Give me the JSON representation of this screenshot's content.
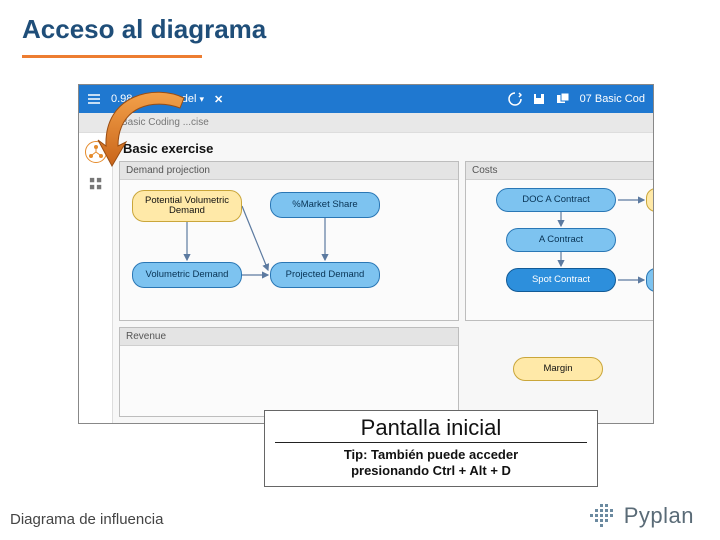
{
  "slide": {
    "title": "Acceso al diagrama",
    "caption_title": "Pantalla inicial",
    "caption_tip_line1": "Tip: También puede acceder",
    "caption_tip_line2": "presionando Ctrl + Alt + D",
    "footer": "Diagrama de influencia",
    "brand": "Pyplan"
  },
  "app": {
    "version": "0.98",
    "menu_label": "Model",
    "close_glyph": "✕",
    "file_label": "07 Basic Cod",
    "breadcrumb": "Basic Coding   ...cise",
    "module_title": "Basic exercise",
    "icons": {
      "save": "save",
      "save_alt": "save-alt",
      "recycle": "recycle"
    }
  },
  "panels": {
    "demand": "Demand projection",
    "costs": "Costs",
    "revenue": "Revenue"
  },
  "nodes": {
    "pvd": "Potential Volumetric Demand",
    "ms": "%Market Share",
    "vd": "Volumetric Demand",
    "pd": "Projected Demand",
    "doc": "DOC A Contract",
    "ac": "A Contract",
    "sc": "Spot Contract",
    "margin": "Margin"
  }
}
